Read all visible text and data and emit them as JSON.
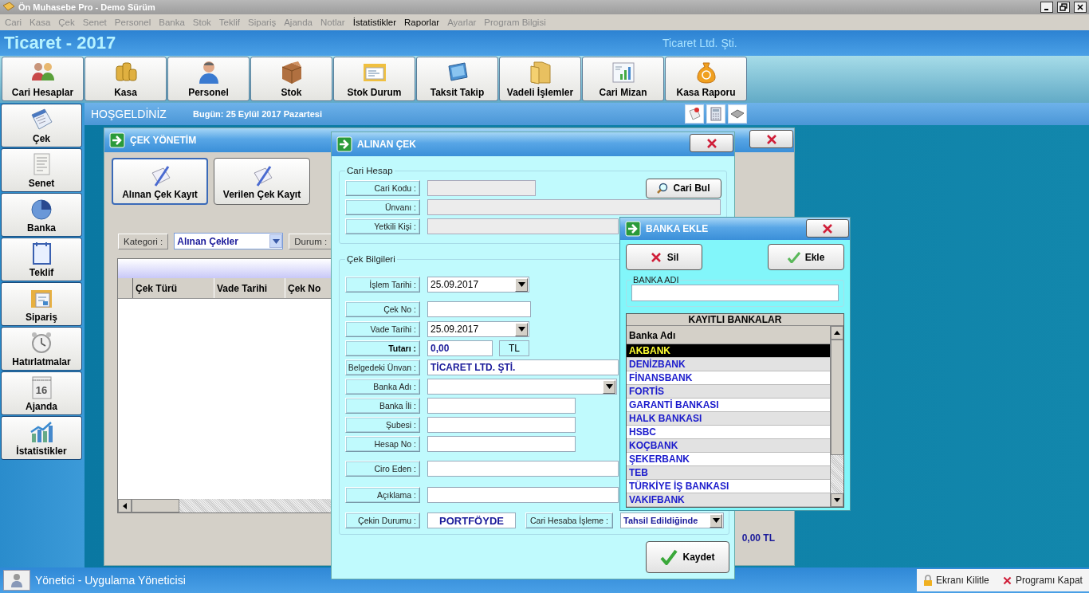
{
  "window": {
    "title": "Ön Muhasebe Pro - Demo Sürüm"
  },
  "menu": [
    {
      "label": "Cari",
      "disabled": true
    },
    {
      "label": "Kasa",
      "disabled": true
    },
    {
      "label": "Çek",
      "disabled": true
    },
    {
      "label": "Senet",
      "disabled": true
    },
    {
      "label": "Personel",
      "disabled": true
    },
    {
      "label": "Banka",
      "disabled": true
    },
    {
      "label": "Stok",
      "disabled": true
    },
    {
      "label": "Teklif",
      "disabled": true
    },
    {
      "label": "Sipariş",
      "disabled": true
    },
    {
      "label": "Ajanda",
      "disabled": true
    },
    {
      "label": "Notlar",
      "disabled": true
    },
    {
      "label": "İstatistikler",
      "disabled": false
    },
    {
      "label": "Raporlar",
      "disabled": false
    },
    {
      "label": "Ayarlar",
      "disabled": true
    },
    {
      "label": "Program Bilgisi",
      "disabled": true
    }
  ],
  "header": {
    "title": "Ticaret - 2017",
    "company": "Ticaret Ltd. Şti."
  },
  "toolbar": [
    {
      "label": "Cari Hesaplar",
      "kind": "people"
    },
    {
      "label": "Kasa",
      "kind": "coins"
    },
    {
      "label": "Personel",
      "kind": "person"
    },
    {
      "label": "Stok",
      "kind": "box"
    },
    {
      "label": "Stok Durum",
      "kind": "docfolder"
    },
    {
      "label": "Taksit Takip",
      "kind": "tablet"
    },
    {
      "label": "Vadeli İşlemler",
      "kind": "folder"
    },
    {
      "label": "Cari Mizan",
      "kind": "chartdoc"
    },
    {
      "label": "Kasa Raporu",
      "kind": "moneybag"
    }
  ],
  "sidebar": [
    {
      "label": "Çek",
      "kind": "notebook"
    },
    {
      "label": "Senet",
      "kind": "paper"
    },
    {
      "label": "Banka",
      "kind": "pie"
    },
    {
      "label": "Teklif",
      "kind": "notepad"
    },
    {
      "label": "Sipariş",
      "kind": "folderdoc"
    },
    {
      "label": "Hatırlatmalar",
      "kind": "clock"
    },
    {
      "label": "Ajanda",
      "kind": "calendar",
      "icon_text": "16"
    },
    {
      "label": "İstatistikler",
      "kind": "bars"
    }
  ],
  "welcome": {
    "title": "HOŞGELDİNİZ",
    "date": "Bugün: 25 Eylül 2017 Pazartesi"
  },
  "cek_yonetim": {
    "title": "ÇEK YÖNETİM",
    "buttons": [
      {
        "label": "Alınan Çek Kayıt",
        "selected": true
      },
      {
        "label": "Verilen Çek Kayıt",
        "selected": false
      }
    ],
    "category_label": "Kategori :",
    "category_value": "Alınan Çekler",
    "status_label": "Durum :",
    "columns": [
      "Çek Türü",
      "Vade Tarihi",
      "Çek No"
    ],
    "total": "0,00 TL"
  },
  "alinan_cek": {
    "title": "ALINAN ÇEK",
    "cari_group": "Cari Hesap",
    "find_button": "Cari Bul",
    "cari_fields": [
      {
        "label": "Cari Kodu :"
      },
      {
        "label": "Ünvanı :"
      },
      {
        "label": "Yetkili Kişi :"
      }
    ],
    "cek_group": "Çek Bilgileri",
    "cek_fields": [
      {
        "label": "İşlem Tarihi :",
        "kind": "date",
        "value": "25.09.2017"
      },
      {
        "label": "Çek No :",
        "kind": "text"
      },
      {
        "label": "Vade Tarihi :",
        "kind": "date",
        "value": "25.09.2017"
      },
      {
        "label": "Tutarı :",
        "kind": "amount",
        "value": "0,00",
        "unit": "TL"
      },
      {
        "label": "Belgedeki Ünvan :",
        "kind": "text",
        "value": "TİCARET LTD. ŞTİ."
      },
      {
        "label": "Banka Adı :",
        "kind": "combo"
      },
      {
        "label": "Banka İli :",
        "kind": "text"
      },
      {
        "label": "Şubesi :",
        "kind": "text"
      },
      {
        "label": "Hesap No :",
        "kind": "text"
      },
      {
        "label": "Ciro Eden :",
        "kind": "text"
      },
      {
        "label": "Açıklama :",
        "kind": "text"
      },
      {
        "label": "Çekin Durumu :",
        "kind": "status",
        "value": "PORTFÖYDE",
        "extra_label": "Cari Hesaba İşleme :",
        "extra_value": "Tahsil Edildiğinde"
      }
    ],
    "save_button": "Kaydet"
  },
  "banka_ekle": {
    "title": "BANKA EKLE",
    "delete_button": "Sil",
    "add_button": "Ekle",
    "name_group": "BANKA ADI",
    "list_title": "KAYITLI BANKALAR",
    "column": "Banka Adı",
    "banks": [
      {
        "name": "AKBANK",
        "selected": true
      },
      {
        "name": "DENİZBANK",
        "selected": false
      },
      {
        "name": "FİNANSBANK",
        "selected": false
      },
      {
        "name": "FORTİS",
        "selected": false
      },
      {
        "name": "GARANTİ BANKASI",
        "selected": false
      },
      {
        "name": "HALK BANKASI",
        "selected": false
      },
      {
        "name": "HSBC",
        "selected": false
      },
      {
        "name": "KOÇBANK",
        "selected": false
      },
      {
        "name": "ŞEKERBANK",
        "selected": false
      },
      {
        "name": "TEB",
        "selected": false
      },
      {
        "name": "TÜRKİYE İŞ BANKASI",
        "selected": false
      },
      {
        "name": "VAKIFBANK",
        "selected": false
      }
    ]
  },
  "status_bar": {
    "user": "Yönetici - Uygulama Yöneticisi",
    "lock": "Ekranı Kilitle",
    "exit": "Programı Kapat"
  }
}
